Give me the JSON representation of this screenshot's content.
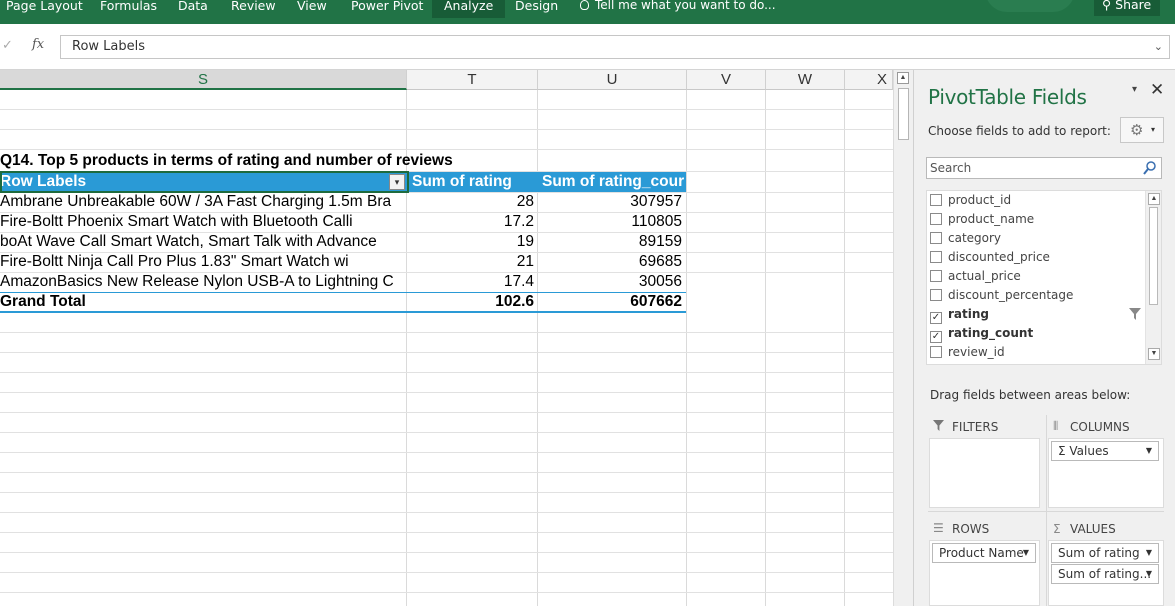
{
  "ribbon": {
    "tabs": [
      {
        "label": "Page Layout"
      },
      {
        "label": "Formulas"
      },
      {
        "label": "Data"
      },
      {
        "label": "Review"
      },
      {
        "label": "View"
      },
      {
        "label": "Power Pivot"
      },
      {
        "label": "Analyze",
        "active": true
      },
      {
        "label": "Design"
      }
    ],
    "tell_me": "Tell me what you want to do...",
    "share": "Share"
  },
  "formula_bar": {
    "fx": "fx",
    "value": "Row Labels"
  },
  "columns": [
    "S",
    "T",
    "U",
    "V",
    "W",
    "X"
  ],
  "pivot": {
    "title": "Q14. Top 5 products in terms of rating and number of reviews",
    "headers": [
      "Row Labels",
      "Sum of rating",
      "Sum of rating_cour"
    ],
    "rows": [
      {
        "label": "Ambrane Unbreakable 60W / 3A Fast Charging 1.5m Bra",
        "rating": "28",
        "count": "307957"
      },
      {
        "label": "Fire-Boltt Phoenix Smart Watch with Bluetooth Calli",
        "rating": "17.2",
        "count": "110805"
      },
      {
        "label": "boAt Wave Call Smart Watch, Smart Talk with Advance",
        "rating": "19",
        "count": "89159"
      },
      {
        "label": "Fire-Boltt Ninja Call Pro Plus 1.83\" Smart Watch wi",
        "rating": "21",
        "count": "69685"
      },
      {
        "label": "AmazonBasics New Release Nylon USB-A to Lightning C",
        "rating": "17.4",
        "count": "30056"
      }
    ],
    "grand_total": {
      "label": "Grand Total",
      "rating": "102.6",
      "count": "607662"
    }
  },
  "pane": {
    "title": "PivotTable Fields",
    "choose": "Choose fields to add to report:",
    "search_placeholder": "Search",
    "fields": [
      {
        "name": "product_id",
        "checked": false
      },
      {
        "name": "product_name",
        "checked": false
      },
      {
        "name": "category",
        "checked": false
      },
      {
        "name": "discounted_price",
        "checked": false
      },
      {
        "name": "actual_price",
        "checked": false
      },
      {
        "name": "discount_percentage",
        "checked": false
      },
      {
        "name": "rating",
        "checked": true
      },
      {
        "name": "rating_count",
        "checked": true
      },
      {
        "name": "review_id",
        "checked": false
      }
    ],
    "drag_text": "Drag fields between areas below:",
    "areas": {
      "filters": "FILTERS",
      "columns": "COLUMNS",
      "rows": "ROWS",
      "values": "VALUES"
    },
    "columns_items": [
      "Values"
    ],
    "rows_items": [
      "Product Name"
    ],
    "values_items": [
      "Sum of rating",
      "Sum of rating..."
    ]
  }
}
